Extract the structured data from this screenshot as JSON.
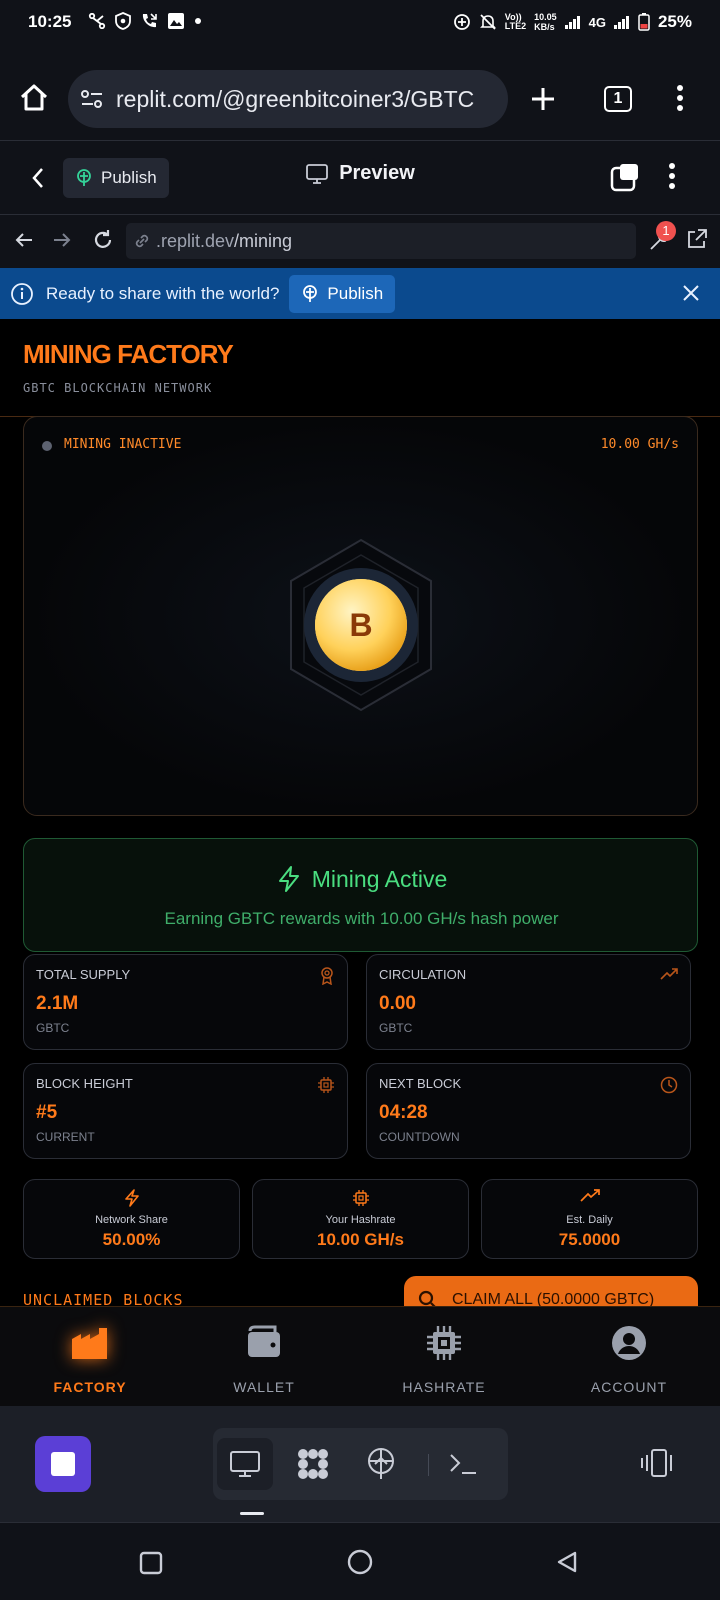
{
  "status_bar": {
    "time": "10:25",
    "speed_top": "10.05",
    "speed_bottom": "KB/s",
    "volte": "Vo))",
    "lte": "LTE2",
    "network": "4G",
    "battery": "25%"
  },
  "browser": {
    "url": "replit.com/@greenbitcoiner3/GBTC",
    "tab_count": "1"
  },
  "replit_header": {
    "publish_label": "Publish",
    "preview_label": "Preview"
  },
  "preview_bar": {
    "url_domain": ".replit.dev",
    "url_path": "/mining",
    "badge_count": "1"
  },
  "banner": {
    "text": "Ready to share with the world?",
    "publish_label": "Publish"
  },
  "app": {
    "title": "MINING FACTORY",
    "subtitle": "GBTC BLOCKCHAIN NETWORK",
    "mining_panel": {
      "status": "MINING INACTIVE",
      "rate": "10.00 GH/s",
      "coin_symbol": "B"
    },
    "active_card": {
      "title": "Mining Active",
      "subtitle": "Earning GBTC rewards with 10.00 GH/s hash power"
    },
    "stats": [
      {
        "label": "TOTAL SUPPLY",
        "value": "2.1M",
        "unit": "GBTC",
        "icon": "award-icon"
      },
      {
        "label": "CIRCULATION",
        "value": "0.00",
        "unit": "GBTC",
        "icon": "trending-up-icon"
      },
      {
        "label": "BLOCK HEIGHT",
        "value": "#5",
        "unit": "CURRENT",
        "icon": "cpu-icon"
      },
      {
        "label": "NEXT BLOCK",
        "value": "04:28",
        "unit": "COUNTDOWN",
        "icon": "clock-icon"
      }
    ],
    "mini_stats": [
      {
        "label": "Network Share",
        "value": "50.00%",
        "icon": "bolt-icon"
      },
      {
        "label": "Your Hashrate",
        "value": "10.00 GH/s",
        "icon": "cpu-icon"
      },
      {
        "label": "Est. Daily",
        "value": "75.0000",
        "icon": "trending-up-icon"
      }
    ],
    "unclaimed_label": "UNCLAIMED BLOCKS",
    "claim_label": "CLAIM ALL (50.0000 GBTC)",
    "nav": [
      {
        "label": "FACTORY",
        "active": true
      },
      {
        "label": "WALLET",
        "active": false
      },
      {
        "label": "HASHRATE",
        "active": false
      },
      {
        "label": "ACCOUNT",
        "active": false
      }
    ]
  },
  "colors": {
    "accent": "#ff7a1a",
    "success": "#4ade80",
    "banner": "#0b4a8e",
    "run_button": "#5b3fd6"
  }
}
